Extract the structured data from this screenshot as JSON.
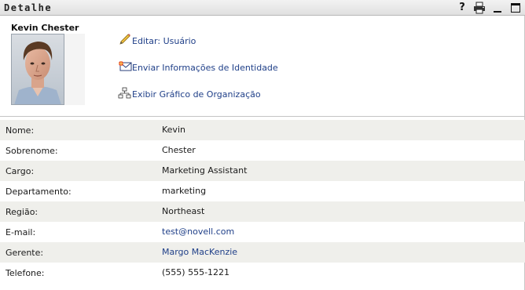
{
  "titlebar": {
    "title": "Detalhe",
    "help_label": "?"
  },
  "profile": {
    "name": "Kevin Chester"
  },
  "actions": {
    "edit": "Editar: Usuário",
    "send": "Enviar Informações de Identidade",
    "org": "Exibir Gráfico de Organização"
  },
  "details": {
    "rows": [
      {
        "label": "Nome:",
        "value": "Kevin"
      },
      {
        "label": "Sobrenome:",
        "value": "Chester"
      },
      {
        "label": "Cargo:",
        "value": "Marketing Assistant"
      },
      {
        "label": "Departamento:",
        "value": "marketing"
      },
      {
        "label": "Região:",
        "value": "Northeast"
      },
      {
        "label": "E-mail:",
        "value": "test@novell.com"
      },
      {
        "label": "Gerente:",
        "value": "Margo MacKenzie"
      },
      {
        "label": "Telefone:",
        "value": "(555) 555-1221"
      }
    ]
  },
  "colors": {
    "link": "#1f3f88",
    "row_shade": "#efefeb",
    "titlebar": "#e6e6e6"
  },
  "icons": {
    "help": "help-icon",
    "print": "print-icon",
    "minimize": "minimize-icon",
    "maximize": "maximize-icon",
    "edit": "pencil-icon",
    "send": "envelope-icon",
    "org": "org-chart-icon"
  }
}
